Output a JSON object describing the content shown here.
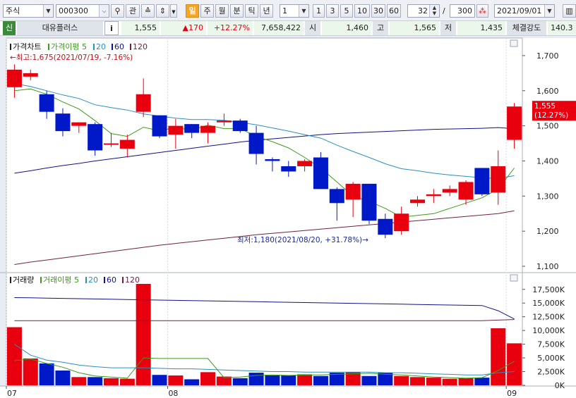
{
  "toolbar": {
    "market_type": "주식",
    "stock_code": "000300",
    "search_label": "관",
    "period_buttons": [
      "일",
      "주",
      "월",
      "분",
      "틱",
      "년"
    ],
    "interval_value": "1",
    "count_buttons": [
      "1",
      "3",
      "5",
      "10",
      "30",
      "60"
    ],
    "view_count": "32",
    "total_count": "300",
    "separator": "/",
    "date": "2021/09/01"
  },
  "quote": {
    "market_badge": "신",
    "name": "대유플러스",
    "info_label": "i",
    "price": "1,555",
    "change": "▲170",
    "change_rate": "+12.27%",
    "volume": "7,658,422",
    "open_label": "시",
    "open": "1,460",
    "high_label": "고",
    "high": "1,565",
    "low_label": "저",
    "low": "1,435",
    "strength_label": "체결강도",
    "strength": "140.3"
  },
  "price_panel": {
    "legend_main": "가격차트",
    "legend_ma_label": "가격이평",
    "ma_periods": [
      "5",
      "20",
      "60",
      "120"
    ],
    "high_annotation": "←최고:1,675(2021/07/19, -7.16%)",
    "low_annotation": "최저:1,180(2021/08/20, +31.78%)→",
    "current_tag_price": "1,555",
    "current_tag_rate": "(12.27%)",
    "y_ticks": [
      "1,700",
      "1,600",
      "1,500",
      "1,400",
      "1,300",
      "1,200",
      "1,100"
    ]
  },
  "volume_panel": {
    "legend_main": "거래량",
    "legend_ma_label": "거래이평",
    "ma_periods": [
      "5",
      "20",
      "60",
      "120"
    ],
    "y_ticks": [
      "17,500K",
      "15,000K",
      "12,500K",
      "10,000K",
      "7,500K",
      "5,000K",
      "2,500K",
      "0K"
    ]
  },
  "x_labels": [
    {
      "label": "07",
      "index": 0
    },
    {
      "label": "08",
      "index": 10
    },
    {
      "label": "09",
      "index": 31
    }
  ],
  "colors": {
    "up": "#e8000f",
    "down": "#0019c8",
    "ma5": "#3c9a1c",
    "ma20": "#2a8fc0",
    "ma60": "#101090",
    "ma120": "#702040",
    "quote_red": "#e0001a"
  },
  "chart_data": [
    {
      "type": "candlestick",
      "title": "가격차트",
      "ylim": [
        1080,
        1740
      ],
      "ohlc": [
        [
          1610,
          1675,
          1580,
          1660
        ],
        [
          1640,
          1660,
          1630,
          1650
        ],
        [
          1590,
          1600,
          1520,
          1540
        ],
        [
          1535,
          1550,
          1470,
          1485
        ],
        [
          1500,
          1510,
          1480,
          1510
        ],
        [
          1505,
          1510,
          1415,
          1430
        ],
        [
          1450,
          1480,
          1440,
          1450
        ],
        [
          1435,
          1475,
          1410,
          1460
        ],
        [
          1540,
          1635,
          1525,
          1590
        ],
        [
          1530,
          1530,
          1465,
          1470
        ],
        [
          1475,
          1520,
          1435,
          1500
        ],
        [
          1505,
          1505,
          1465,
          1480
        ],
        [
          1480,
          1510,
          1450,
          1500
        ],
        [
          1510,
          1535,
          1500,
          1515
        ],
        [
          1515,
          1520,
          1480,
          1485
        ],
        [
          1480,
          1500,
          1390,
          1420
        ],
        [
          1405,
          1410,
          1370,
          1400
        ],
        [
          1385,
          1400,
          1355,
          1370
        ],
        [
          1385,
          1405,
          1370,
          1400
        ],
        [
          1410,
          1425,
          1330,
          1320
        ],
        [
          1320,
          1325,
          1230,
          1280
        ],
        [
          1290,
          1340,
          1240,
          1335
        ],
        [
          1335,
          1335,
          1220,
          1230
        ],
        [
          1235,
          1250,
          1180,
          1190
        ],
        [
          1200,
          1270,
          1190,
          1250
        ],
        [
          1280,
          1300,
          1270,
          1290
        ],
        [
          1300,
          1320,
          1280,
          1305
        ],
        [
          1310,
          1330,
          1300,
          1320
        ],
        [
          1290,
          1345,
          1275,
          1340
        ],
        [
          1380,
          1380,
          1300,
          1305
        ],
        [
          1310,
          1430,
          1275,
          1385
        ],
        [
          1460,
          1565,
          1435,
          1555
        ]
      ],
      "ma": {
        "5": [
          1600,
          1605,
          1590,
          1568,
          1548,
          1515,
          1478,
          1470,
          1496,
          1486,
          1495,
          1488,
          1502,
          1492,
          1492,
          1470,
          1455,
          1437,
          1410,
          1380,
          1340,
          1300,
          1285,
          1265,
          1240,
          1245,
          1250,
          1265,
          1280,
          1295,
          1320,
          1380
        ],
        "20": [
          1620,
          1612,
          1600,
          1588,
          1578,
          1560,
          1552,
          1545,
          1534,
          1528,
          1522,
          1518,
          1518,
          1516,
          1510,
          1503,
          1494,
          1485,
          1475,
          1465,
          1445,
          1427,
          1410,
          1392,
          1378,
          1372,
          1365,
          1360,
          1356,
          1352,
          1350,
          1358
        ],
        "60": [
          1365,
          1372,
          1380,
          1387,
          1393,
          1400,
          1406,
          1412,
          1418,
          1424,
          1430,
          1436,
          1442,
          1448,
          1454,
          1459,
          1463,
          1467,
          1471,
          1475,
          1478,
          1480,
          1482,
          1484,
          1486,
          1488,
          1490,
          1491,
          1492,
          1493,
          1495,
          1492
        ],
        "120": [
          1105,
          1112,
          1118,
          1124,
          1130,
          1136,
          1142,
          1148,
          1154,
          1160,
          1165,
          1170,
          1175,
          1180,
          1185,
          1190,
          1194,
          1198,
          1202,
          1206,
          1210,
          1214,
          1218,
          1222,
          1226,
          1230,
          1234,
          1238,
          1242,
          1246,
          1250,
          1258
        ]
      }
    },
    {
      "type": "bar",
      "title": "거래량",
      "ylim": [
        0,
        18500
      ],
      "values": [
        10600,
        4900,
        4000,
        2700,
        1500,
        1500,
        1300,
        1200,
        18500,
        1900,
        1800,
        1100,
        2400,
        1600,
        1300,
        2300,
        1800,
        1800,
        2000,
        1700,
        2300,
        2400,
        1700,
        2300,
        1700,
        1500,
        1400,
        1200,
        1300,
        1400,
        10400,
        7658
      ],
      "ma": {
        "5": [
          4500,
          4800,
          4000,
          3300,
          2300,
          1700,
          1500,
          1300,
          5000,
          4900,
          4900,
          4900,
          4900,
          1400,
          1500,
          1800,
          1900,
          1800,
          1900,
          1900,
          2000,
          2100,
          2200,
          2000,
          1900,
          1700,
          1500,
          1400,
          1300,
          1400,
          2700,
          4400
        ],
        "20": [
          7500,
          5500,
          4600,
          4200,
          3700,
          3400,
          3200,
          3200,
          3200,
          3100,
          3000,
          3000,
          2900,
          2800,
          2700,
          2600,
          2500,
          2500,
          2400,
          2400,
          2400,
          2400,
          2400,
          2300,
          2300,
          2200,
          2100,
          2000,
          1900,
          1900,
          2300,
          2500
        ],
        "60": [
          16000,
          15950,
          15900,
          15850,
          15800,
          15750,
          15700,
          15650,
          15600,
          15550,
          15500,
          15450,
          15400,
          15350,
          15300,
          15250,
          15200,
          15150,
          15100,
          15050,
          15000,
          14950,
          14900,
          14850,
          14800,
          14750,
          14700,
          14650,
          14600,
          14550,
          13600,
          12100
        ],
        "120": [
          11800,
          11800,
          11800,
          11800,
          11800,
          11800,
          11800,
          11800,
          11800,
          11800,
          11800,
          11800,
          11800,
          11800,
          11800,
          11800,
          11800,
          11800,
          11800,
          11800,
          11800,
          11800,
          11800,
          11800,
          11800,
          11800,
          11800,
          11800,
          11800,
          11800,
          11900,
          12000
        ]
      }
    }
  ]
}
